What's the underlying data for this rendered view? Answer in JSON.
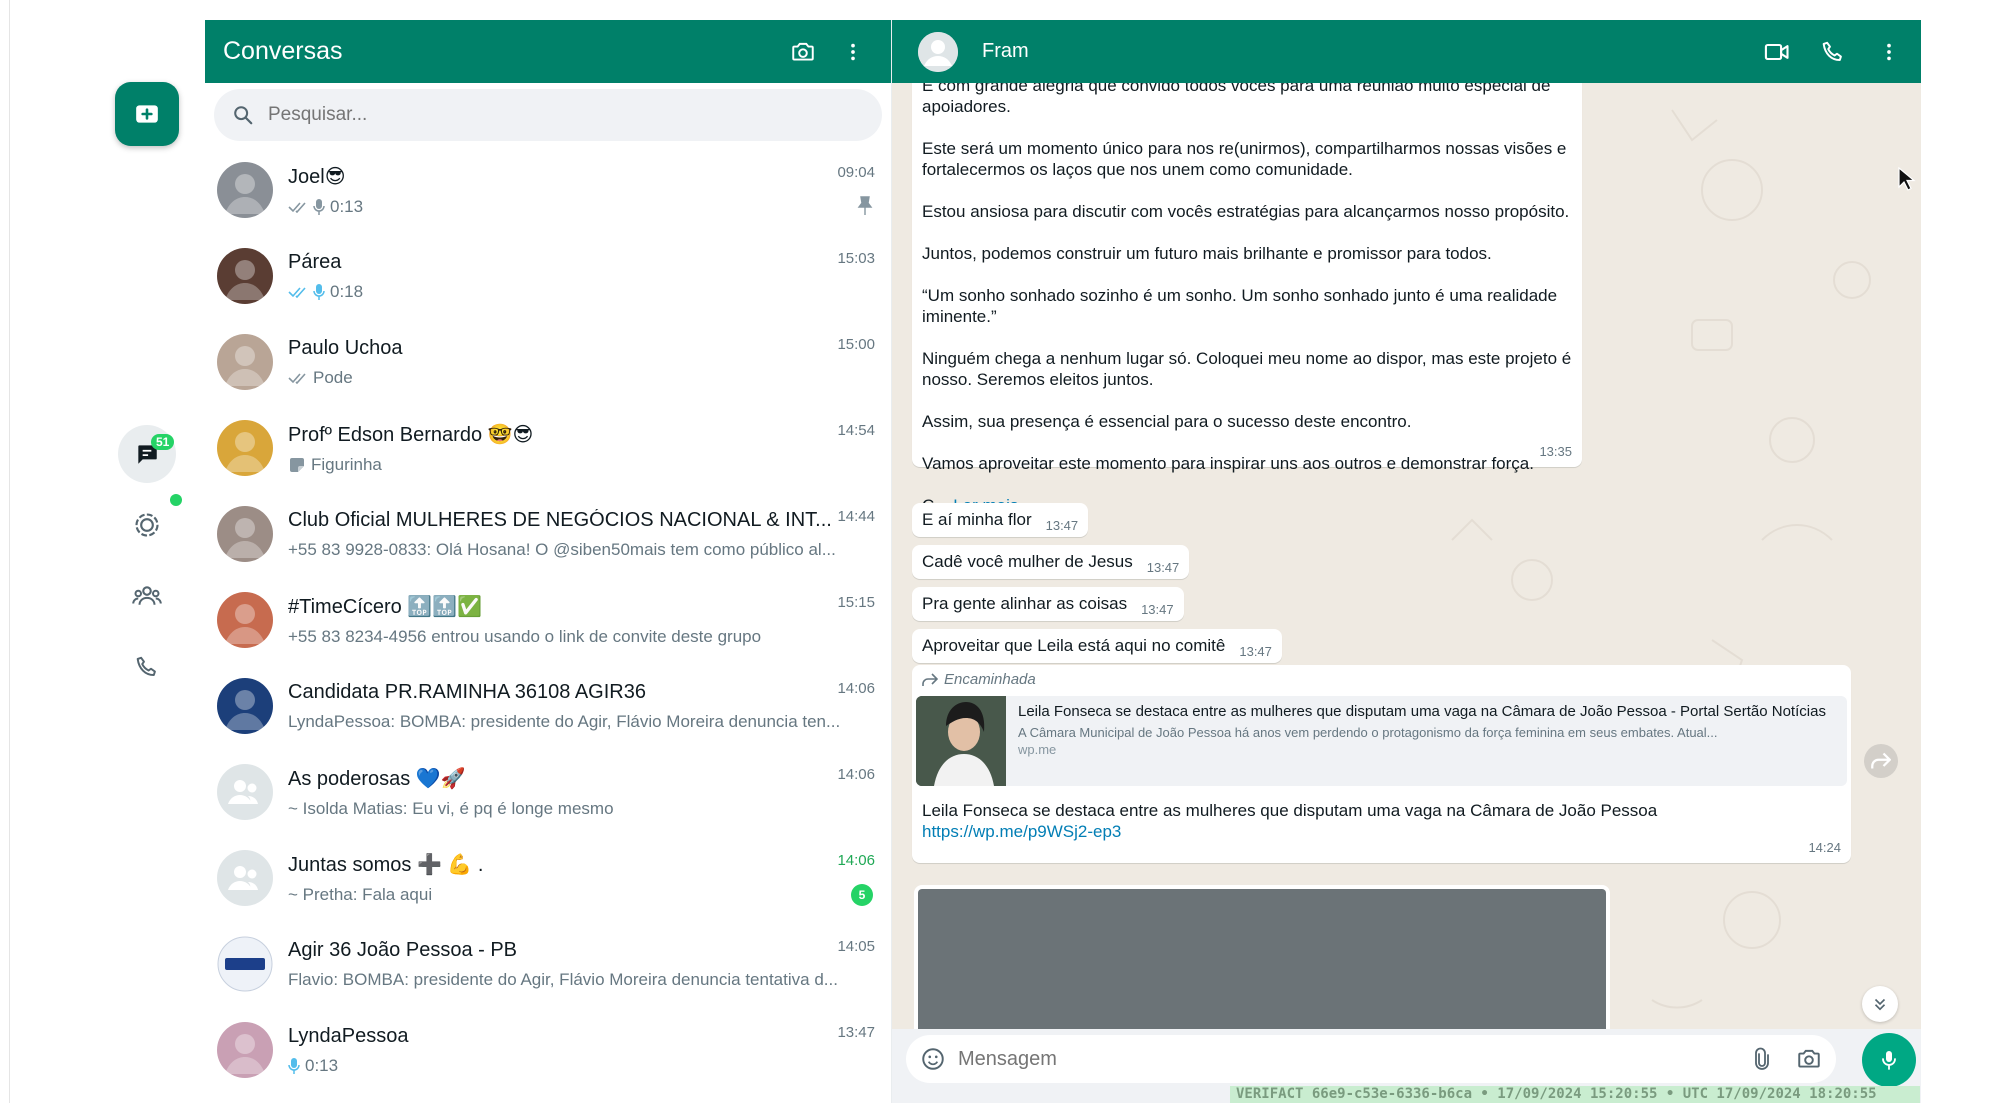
{
  "list": {
    "title": "Conversas",
    "search_placeholder": "Pesquisar...",
    "chats": [
      {
        "name": "Joel😎",
        "preview": "0:13",
        "time": "09:04",
        "avatar_color": "#8a8f96",
        "ticks": "gray",
        "mic": "gray",
        "pinned": true
      },
      {
        "name": "Párea",
        "preview": "0:18",
        "time": "15:03",
        "avatar_color": "#5a3d33",
        "ticks": "blue",
        "mic": "blue"
      },
      {
        "name": "Paulo Uchoa",
        "preview": "Pode",
        "time": "15:00",
        "avatar_color": "#b9a596",
        "ticks": "gray"
      },
      {
        "name": "Profº Edson Bernardo 🤓😎",
        "preview": "Figurinha",
        "time": "14:54",
        "avatar_color": "#d9a63a",
        "sticker": true
      },
      {
        "name": "Club Oficial MULHERES DE NEGÓCIOS NACIONAL & INT...",
        "preview": "+55 83 9928-0833: Olá Hosana! O @siben50mais tem como público al...",
        "time": "14:44",
        "avatar_color": "#9c8d86"
      },
      {
        "name": "#TimeCícero 🔝🔝✅",
        "preview": "+55 83 8234-4956 entrou usando o link de convite deste grupo",
        "time": "15:15",
        "avatar_color": "#c76b4f"
      },
      {
        "name": "Candidata PR.RAMINHA 36108 AGIR36",
        "preview": "LyndaPessoa: BOMBA: presidente do Agir, Flávio Moreira denuncia ten...",
        "time": "14:06",
        "avatar_color": "#1c3f7a"
      },
      {
        "name": "As poderosas 💙🚀",
        "preview": "~ Isolda Matias: Eu vi, é pq é longe mesmo",
        "time": "14:06",
        "avatar_color": "#dfe5e7",
        "group_placeholder": true
      },
      {
        "name": "Juntas somos ➕ 💪 .",
        "preview": "~ Pretha: Fala aqui",
        "time": "14:06",
        "avatar_color": "#dfe5e7",
        "group_placeholder": true,
        "unread": "5",
        "time_green": true
      },
      {
        "name": "Agir 36 João Pessoa - PB",
        "preview": "Flavio: BOMBA: presidente do Agir, Flávio Moreira denuncia tentativa d...",
        "time": "14:05",
        "avatar_color": "#e8eef7",
        "logo": "AGIR36"
      },
      {
        "name": "LyndaPessoa",
        "preview": "0:13",
        "time": "13:47",
        "avatar_color": "#c9a0b4",
        "mic": "blue"
      }
    ]
  },
  "rail": {
    "chats_badge": "51"
  },
  "chat": {
    "contact_name": "Fram",
    "long_message": {
      "lines": [
        "E com grande alegria que convido todos vocês para uma reunião muito especial de apoiadores.",
        "Este será um momento único para nos re(unirmos), compartilharmos nossas visões e fortalecermos os laços que nos unem como comunidade.",
        "Estou ansiosa para discutir com vocês  estratégias para alcançarmos nosso propósito.",
        "Juntos, podemos construir um futuro mais brilhante e promissor para todos.",
        "“Um sonho sonhado sozinho é um sonho. Um sonho sonhado junto é uma realidade iminente.”",
        "Ninguém chega a nenhum lugar só. Coloquei meu nome ao dispor, mas este projeto é nosso. Seremos eleitos juntos.",
        "Assim, sua presença é essencial para o sucesso deste encontro.",
        "Vamos aproveitar este momento para inspirar uns aos outros e demonstrar força."
      ],
      "truncated": "C...",
      "read_more": "Ler mais",
      "time": "13:35"
    },
    "short_messages": [
      {
        "text": "E aí minha flor",
        "time": "13:47"
      },
      {
        "text": "Cadê você mulher de Jesus",
        "time": "13:47"
      },
      {
        "text": "Pra gente alinhar as coisas",
        "time": "13:47"
      },
      {
        "text": "Aproveitar que Leila está aqui no comitê",
        "time": "13:47"
      }
    ],
    "forwarded": {
      "label": "Encaminhada",
      "card_title": "Leila Fonseca se destaca entre as mulheres que disputam uma vaga na Câmara de João Pessoa - Portal Sertão Notícias",
      "card_desc": "A Câmara Municipal de João Pessoa há anos vem perdendo o protagonismo da força feminina em seus embates. Atual...",
      "card_domain": "wp.me",
      "text": "Leila Fonseca se destaca entre as mulheres que disputam uma vaga na Câmara de João Pessoa",
      "url": "https://wp.me/p9WSj2-ep3",
      "time": "14:24"
    },
    "composer_placeholder": "Mensagem"
  },
  "verifact": "VERIFACT 66e9-c53e-6336-b6ca • 17/09/2024 15:20:55 • UTC 17/09/2024 18:20:55",
  "colors": {
    "brand": "#008069",
    "accent_green": "#25d366",
    "chat_bg": "#efeae2",
    "link": "#027eb5"
  }
}
